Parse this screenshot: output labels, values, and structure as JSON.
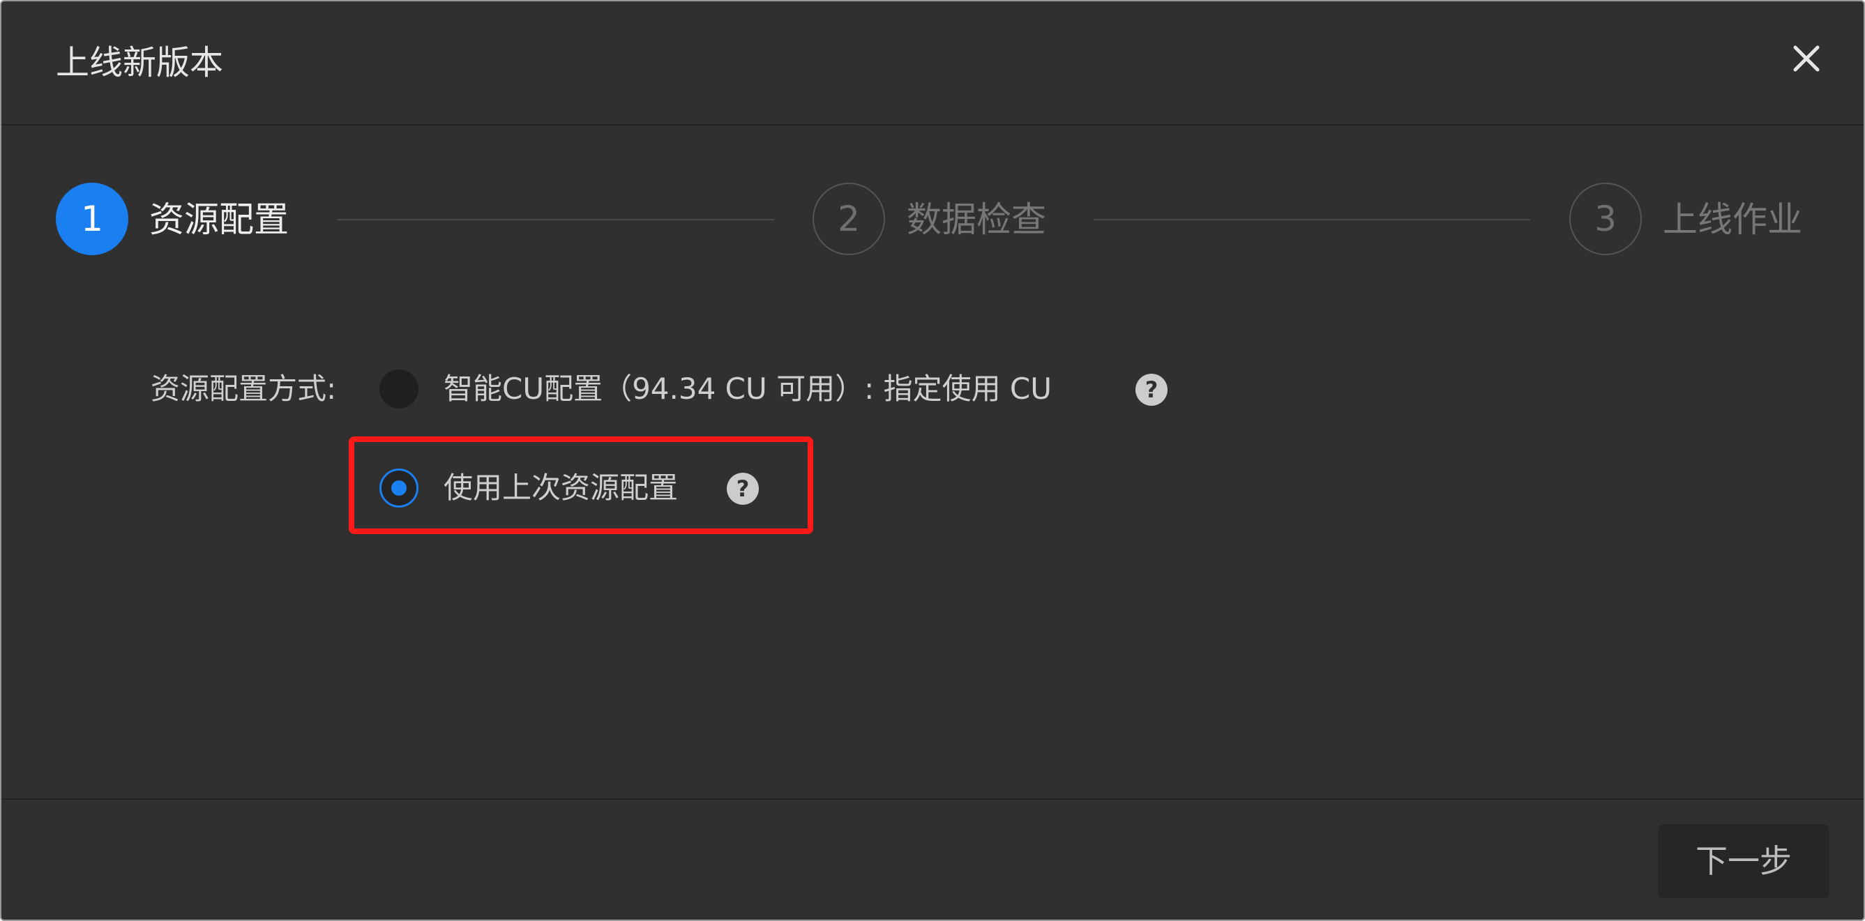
{
  "dialog": {
    "title": "上线新版本"
  },
  "steps": [
    {
      "number": "1",
      "label": "资源配置",
      "state": "active"
    },
    {
      "number": "2",
      "label": "数据检查",
      "state": "inactive"
    },
    {
      "number": "3",
      "label": "上线作业",
      "state": "inactive"
    }
  ],
  "form": {
    "label": "资源配置方式:",
    "options": [
      {
        "text": "智能CU配置（94.34 CU 可用）: 指定使用 CU",
        "selected": false
      },
      {
        "text": "使用上次资源配置",
        "selected": true
      }
    ],
    "help_glyph": "?"
  },
  "footer": {
    "next_label": "下一步"
  },
  "colors": {
    "accent": "#1a7ff0",
    "highlight": "#ff1a1a",
    "background": "#303030"
  },
  "icons": [
    "close-icon",
    "help-icon"
  ]
}
